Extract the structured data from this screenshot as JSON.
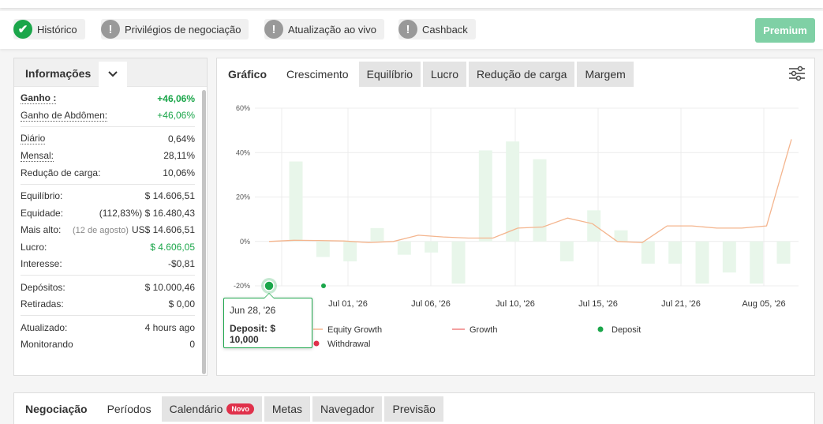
{
  "badges": [
    {
      "label": "Histórico",
      "icon": "check-icon"
    },
    {
      "label": "Privilégios de negociação",
      "icon": "exclamation-icon"
    },
    {
      "label": "Atualização ao vivo",
      "icon": "exclamation-icon"
    },
    {
      "label": "Cashback",
      "icon": "exclamation-icon"
    }
  ],
  "premium_label": "Premium",
  "info": {
    "title": "Informações",
    "rows": {
      "gain": {
        "label": "Ganho :",
        "value": "+46,06%"
      },
      "abs_gain": {
        "label": "Ganho de Abdômen:",
        "value": "+46,06%"
      },
      "daily": {
        "label": "Diário",
        "value": "0,64%"
      },
      "monthly": {
        "label": "Mensal:",
        "value": "28,11%"
      },
      "drawdown": {
        "label": "Redução de carga:",
        "value": "10,06%"
      },
      "balance": {
        "label": "Equilíbrio:",
        "value": "$ 14.606,51"
      },
      "equity": {
        "label": "Equidade:",
        "note": "(112,83%)",
        "value": "$ 16.480,43"
      },
      "highest": {
        "label": "Mais alto:",
        "note": "(12 de agosto)",
        "value": "US$ 14.606,51"
      },
      "profit": {
        "label": "Lucro:",
        "value": "$ 4.606,05"
      },
      "interest": {
        "label": "Interesse:",
        "value": "-$0,81"
      },
      "deposits": {
        "label": "Depósitos:",
        "value": "$ 10.000,46"
      },
      "withdrawals": {
        "label": "Retiradas:",
        "value": "$ 0,00"
      },
      "updated": {
        "label": "Atualizado:",
        "value": "4 hours ago"
      },
      "tracking": {
        "label": "Monitorando",
        "value": "0"
      }
    }
  },
  "chart_tabs": {
    "head": "Gráfico",
    "items": [
      "Crescimento",
      "Equilíbrio",
      "Lucro",
      "Redução de carga",
      "Margem"
    ],
    "active": "Crescimento"
  },
  "bottom_tabs": {
    "head": "Negociação",
    "items": [
      "Períodos",
      "Calendário",
      "Metas",
      "Navegador",
      "Previsão"
    ],
    "new_label": "Novo"
  },
  "tooltip": {
    "date": "Jun 28, '26",
    "text": "Deposit: $ 10,000"
  },
  "colors": {
    "green": "#1ba64a",
    "growth_line": "#f4b58e",
    "bar": "#e8f6ea",
    "deposit": "#1ba64a",
    "withdrawal": "#e0314b"
  },
  "chart_data": {
    "type": "line",
    "ylim": [
      -20,
      60
    ],
    "yticks": [
      "60%",
      "40%",
      "20%",
      "0%",
      "-20%"
    ],
    "xticks": [
      "Jul 01, '26",
      "Jul 06, '26",
      "Jul 10, '26",
      "Jul 15, '26",
      "Jul 21, '26",
      "Aug 05, '26"
    ],
    "legend": [
      "Equity Growth",
      "Growth",
      "Deposit",
      "Withdrawal"
    ],
    "bars": [
      36,
      -7,
      -9,
      6,
      -6,
      -5,
      -19,
      41,
      45,
      37,
      -9,
      14,
      5,
      -10,
      -10,
      -19,
      -14,
      -19,
      -10
    ],
    "growth": [
      0,
      0.5,
      0.4,
      0.2,
      -0.5,
      0,
      2.8,
      2,
      1.5,
      1.5,
      6,
      6.5,
      10.5,
      8,
      0,
      -0.5,
      7,
      7,
      6,
      6,
      7,
      46
    ],
    "deposit_point": {
      "date": "Jun 28, '26",
      "value": 10000
    }
  }
}
